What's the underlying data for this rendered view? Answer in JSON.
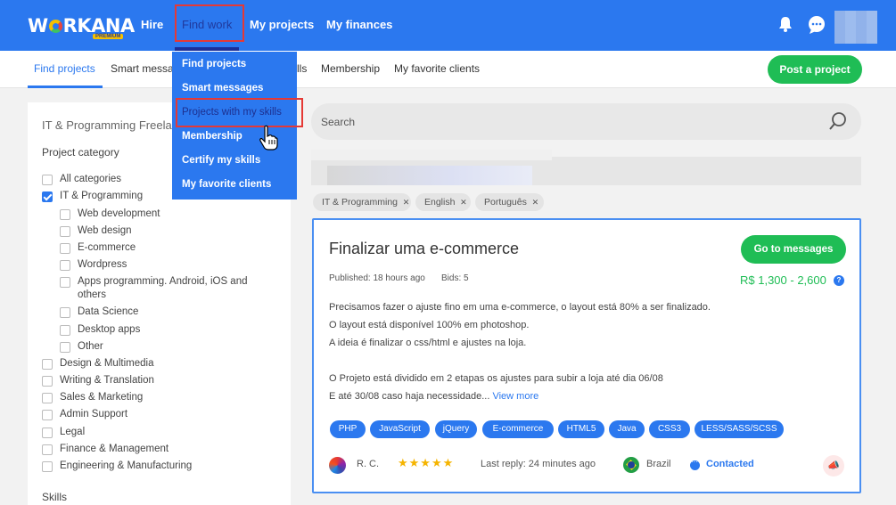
{
  "topnav": {
    "logo_text": "WORKANA",
    "logo_badge": "PREMIUM",
    "links": [
      {
        "label": "Hire"
      },
      {
        "label": "Find work"
      },
      {
        "label": "My projects"
      },
      {
        "label": "My finances"
      }
    ],
    "icons": [
      "bell-icon",
      "chat-icon"
    ]
  },
  "subnav": {
    "links": [
      "Find projects",
      "Smart messa",
      "lls",
      "Membership",
      "My favorite clients"
    ],
    "post_button": "Post a project"
  },
  "dropdown": {
    "items": [
      "Find projects",
      "Smart messages",
      "Projects with my skills",
      "Membership",
      "Certify my skills",
      "My favorite clients"
    ]
  },
  "sidebar": {
    "title": "IT & Programming Freela",
    "category_label": "Project category",
    "categories": [
      {
        "label": "All categories",
        "checked": false,
        "level": 0
      },
      {
        "label": "IT & Programming",
        "checked": true,
        "level": 0
      },
      {
        "label": "Web development",
        "checked": false,
        "level": 1
      },
      {
        "label": "Web design",
        "checked": false,
        "level": 1
      },
      {
        "label": "E-commerce",
        "checked": false,
        "level": 1
      },
      {
        "label": "Wordpress",
        "checked": false,
        "level": 1
      },
      {
        "label": "Apps programming. Android, iOS and",
        "label2": "others",
        "checked": false,
        "level": 1
      },
      {
        "label": "Data Science",
        "checked": false,
        "level": 1
      },
      {
        "label": "Desktop apps",
        "checked": false,
        "level": 1
      },
      {
        "label": "Other",
        "checked": false,
        "level": 1
      },
      {
        "label": "Design & Multimedia",
        "checked": false,
        "level": 0
      },
      {
        "label": "Writing & Translation",
        "checked": false,
        "level": 0
      },
      {
        "label": "Sales & Marketing",
        "checked": false,
        "level": 0
      },
      {
        "label": "Admin Support",
        "checked": false,
        "level": 0
      },
      {
        "label": "Legal",
        "checked": false,
        "level": 0
      },
      {
        "label": "Finance & Management",
        "checked": false,
        "level": 0
      },
      {
        "label": "Engineering & Manufacturing",
        "checked": false,
        "level": 0
      }
    ],
    "skills_label": "Skills"
  },
  "search": {
    "placeholder": "Search"
  },
  "filters": [
    "IT & Programming",
    "English",
    "Português"
  ],
  "project": {
    "title": "Finalizar uma e-commerce",
    "cta": "Go to messages",
    "published": "Published: 18 hours ago",
    "bids": "Bids: 5",
    "price": "R$ 1,300 - 2,600",
    "help": "?",
    "description": [
      "Precisamos fazer o ajuste fino em uma e-commerce, o layout está 80% a ser finalizado.",
      "O  layout está disponível 100% em photoshop.",
      "A ideia é finalizar o css/html e ajustes na loja.",
      "",
      "O Projeto está dividido em 2 etapas os ajustes para subir a loja até dia 06/08",
      "E até 30/08 caso haja necessidade..."
    ],
    "view_more": "View more",
    "tags": [
      "PHP",
      "JavaScript",
      "jQuery",
      "E-commerce",
      "HTML5",
      "Java",
      "CSS3",
      "LESS/SASS/SCSS"
    ],
    "client": "R. C.",
    "rating": 5,
    "stars": "★★★★★",
    "last_reply": "Last reply: 24 minutes ago",
    "country": "Brazil",
    "status": "Contacted"
  },
  "colors": {
    "primary": "#2b78ef",
    "green": "#1fbd55",
    "highlight_border": "#e53935"
  }
}
